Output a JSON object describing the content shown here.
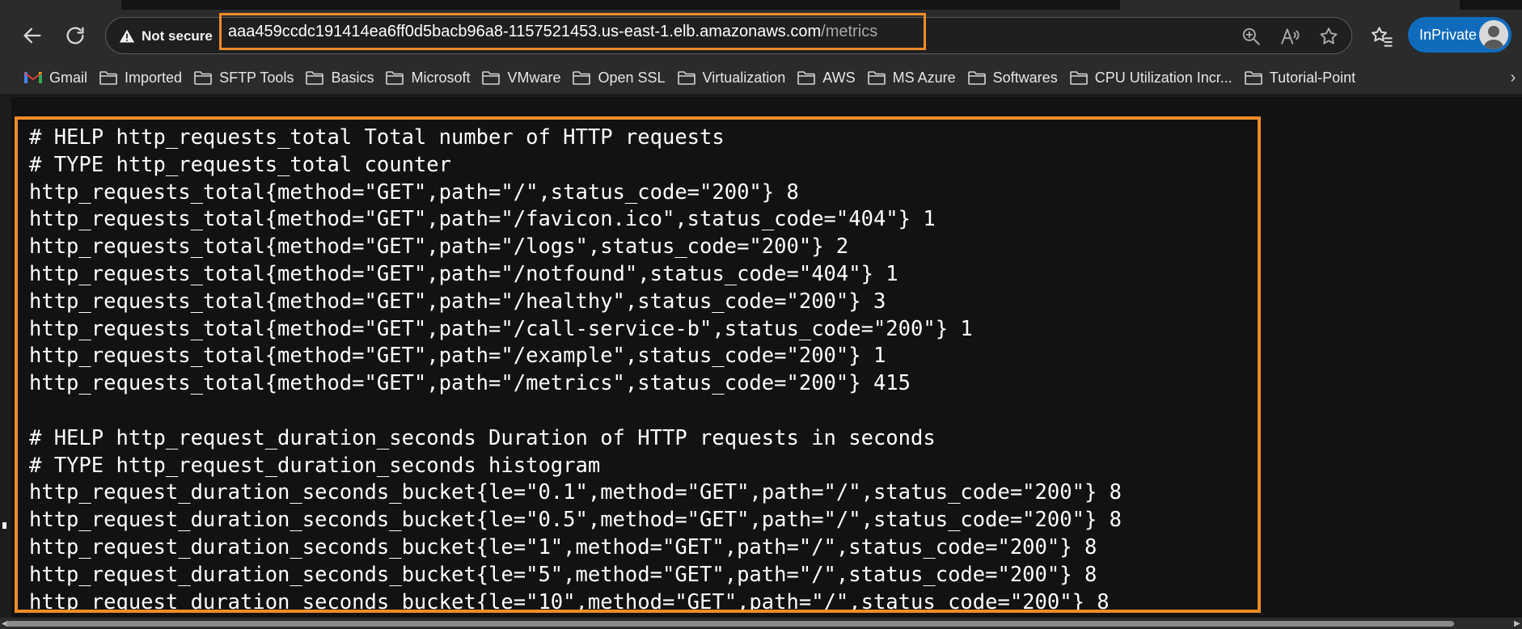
{
  "toolbar": {
    "security_label": "Not secure",
    "url_host": "aaa459ccdc191414ea6ff0d5bacb96a8-1157521453.us-east-1.elb.amazonaws.com",
    "url_path": "/metrics",
    "inprivate_label": "InPrivate"
  },
  "bookmarks": [
    {
      "label": "Gmail",
      "icon": "gmail-icon"
    },
    {
      "label": "Imported",
      "icon": "folder-icon"
    },
    {
      "label": "SFTP Tools",
      "icon": "folder-icon"
    },
    {
      "label": "Basics",
      "icon": "folder-icon"
    },
    {
      "label": "Microsoft",
      "icon": "folder-icon"
    },
    {
      "label": "VMware",
      "icon": "folder-icon"
    },
    {
      "label": "Open SSL",
      "icon": "folder-icon"
    },
    {
      "label": "Virtualization",
      "icon": "folder-icon"
    },
    {
      "label": "AWS",
      "icon": "folder-icon"
    },
    {
      "label": "MS Azure",
      "icon": "folder-icon"
    },
    {
      "label": "Softwares",
      "icon": "folder-icon"
    },
    {
      "label": "CPU Utilization Incr...",
      "icon": "folder-icon"
    },
    {
      "label": "Tutorial-Point",
      "icon": "folder-icon"
    }
  ],
  "metrics_lines": [
    "# HELP http_requests_total Total number of HTTP requests",
    "# TYPE http_requests_total counter",
    "http_requests_total{method=\"GET\",path=\"/\",status_code=\"200\"} 8",
    "http_requests_total{method=\"GET\",path=\"/favicon.ico\",status_code=\"404\"} 1",
    "http_requests_total{method=\"GET\",path=\"/logs\",status_code=\"200\"} 2",
    "http_requests_total{method=\"GET\",path=\"/notfound\",status_code=\"404\"} 1",
    "http_requests_total{method=\"GET\",path=\"/healthy\",status_code=\"200\"} 3",
    "http_requests_total{method=\"GET\",path=\"/call-service-b\",status_code=\"200\"} 1",
    "http_requests_total{method=\"GET\",path=\"/example\",status_code=\"200\"} 1",
    "http_requests_total{method=\"GET\",path=\"/metrics\",status_code=\"200\"} 415",
    "",
    "# HELP http_request_duration_seconds Duration of HTTP requests in seconds",
    "# TYPE http_request_duration_seconds histogram",
    "http_request_duration_seconds_bucket{le=\"0.1\",method=\"GET\",path=\"/\",status_code=\"200\"} 8",
    "http_request_duration_seconds_bucket{le=\"0.5\",method=\"GET\",path=\"/\",status_code=\"200\"} 8",
    "http_request_duration_seconds_bucket{le=\"1\",method=\"GET\",path=\"/\",status_code=\"200\"} 8",
    "http_request_duration_seconds_bucket{le=\"5\",method=\"GET\",path=\"/\",status_code=\"200\"} 8",
    "http_request_duration_seconds_bucket{le=\"10\",method=\"GET\",path=\"/\",status_code=\"200\"} 8"
  ],
  "colors": {
    "highlight": "#f08a2a",
    "inprivate": "#0f6cbd",
    "background": "#121212"
  }
}
